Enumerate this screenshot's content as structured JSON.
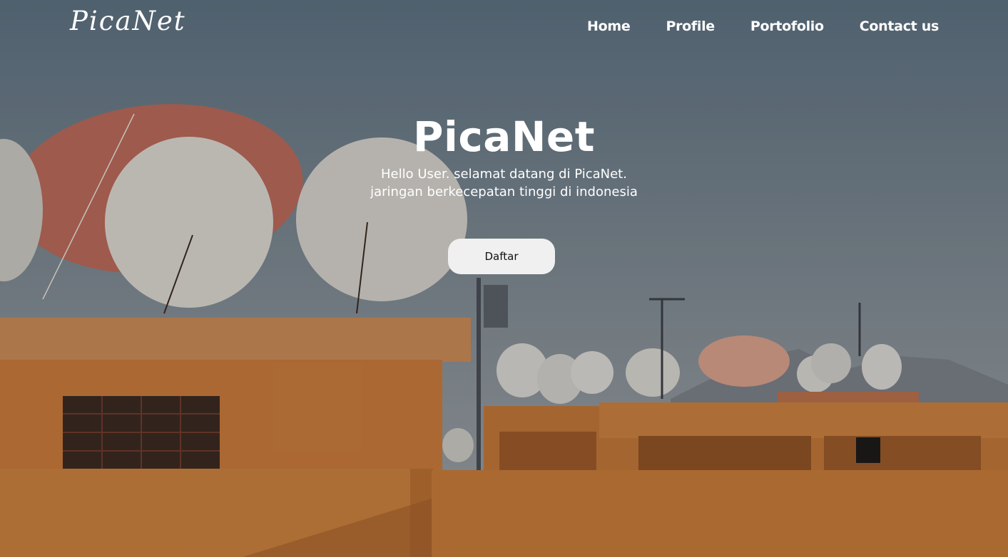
{
  "brand": {
    "logo": "PicaNet"
  },
  "nav": {
    "items": [
      "Home",
      "Profile",
      "Portofolio",
      "Contact us"
    ]
  },
  "hero": {
    "title": "PicaNet",
    "subtitle_line1": "Hello User. selamat datang di PicaNet.",
    "subtitle_line2": "jaringan berkecepatan tinggi di indonesia",
    "cta_label": "Daftar"
  },
  "colors": {
    "text": "#ffffff",
    "button_bg": "#f0f0f0",
    "building": "#c77a3c",
    "sky": "#7f8d97"
  }
}
